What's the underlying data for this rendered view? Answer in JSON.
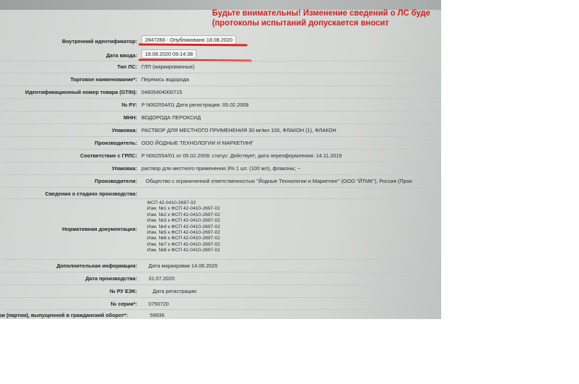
{
  "warning": {
    "line1": "Будьте внимательны! Изменение сведений о ЛС буде",
    "line2": "(протоколы испытаний допускается вносит"
  },
  "fields": [
    {
      "label": "Внутренний идентификатор:",
      "value": "2847266 - Опубликовано 18.08.2020"
    },
    {
      "label": "Дата ввода:",
      "value": "18.08.2020 09:14:38"
    },
    {
      "label": "Тип ЛС:",
      "value": "ГЛП (маркированные)"
    },
    {
      "label": "Торговое наименование*:",
      "value": "Перекись водорода"
    },
    {
      "label": "Идентификационный номер товара (GTIN):",
      "value": "04605404000715"
    },
    {
      "label": "№ РУ:",
      "value": "Р N002554/01 Дата регистрации: 05.02.2009"
    },
    {
      "label": "МНН:",
      "value": "ВОДОРОДА ПЕРОКСИД"
    },
    {
      "label": "Упаковка:",
      "value": "РАСТВОР ДЛЯ МЕСТНОГО ПРИМЕНЕНИЯ 30 мг/мл 100, ФЛАКОН (1), ФЛАКОН"
    },
    {
      "label": "Производитель:",
      "value": "ООО ЙОДНЫЕ ТЕХНОЛОГИИ И МАРКЕТИНГ"
    },
    {
      "label": "Соответствие с ГРЛС:",
      "value": "Р N002554/01 от 05.02.2009; статус: Действует; дата переоформления: 14.11.2019"
    },
    {
      "label": "Упаковка:",
      "value": "раствор для местного применения 3% 1 шт. (100 мл), флаконы; ~"
    },
    {
      "label": "Производители:",
      "value": "Общество с ограниченной ответственностью \"Йодные Технологии и Маркетинг\" (ООО \"ЙТМК\"), Россия (Прои"
    },
    {
      "label": "Сведения о стадиях производства:",
      "value": ""
    }
  ],
  "normative": {
    "label": "Нормативная документация:",
    "items": [
      "ФСП 42-0410-2697-02",
      "Изм. №1 к ФСП 42-0410-2697-02",
      "Изм. №2 к ФСП 42-0410-2697-02",
      "Изм. №3 к ФСП 42-0410-2697-02",
      "Изм. №4 к ФСП 42-0410-2697-02",
      "Изм. №5 к ФСП 42-0410-2697-02",
      "Изм. №6 к ФСП 42-0410-2697-02",
      "Изм. №7 к ФСП 42-0410-2697-02",
      "Изм. №8 к ФСП 42-0410-2697-02"
    ]
  },
  "bottom_fields": [
    {
      "label": "Дополнительная информация:",
      "value": "Дата маркировки 14.08.2020"
    },
    {
      "label": "Дата производства:",
      "value": "31.07.2020"
    },
    {
      "label": "№ РУ ЕЭК:",
      "value": "Дата регистрации:"
    },
    {
      "label": "№ серии*:",
      "value": "0750720"
    },
    {
      "label": "ри (партии), выпущенной в гражданский оборот*:",
      "value": "59936"
    }
  ],
  "colors": {
    "warning": "#d21f1f",
    "underline": "#e2231a"
  }
}
